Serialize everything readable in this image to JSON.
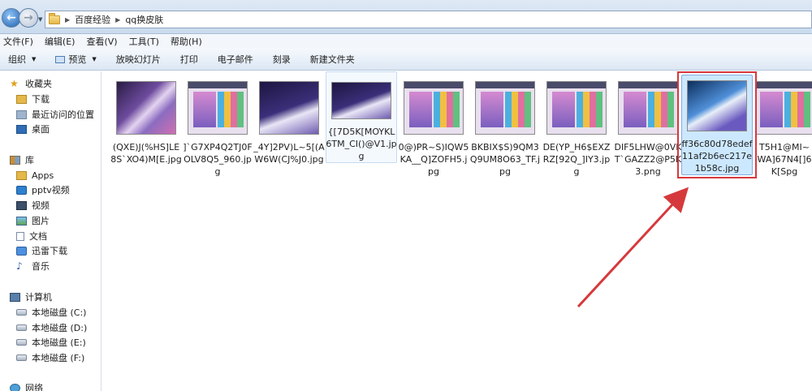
{
  "address": {
    "crumbs": [
      "百度经验",
      "qq换皮肤"
    ]
  },
  "menu": [
    "文件(F)",
    "编辑(E)",
    "查看(V)",
    "工具(T)",
    "帮助(H)"
  ],
  "commands": {
    "organize": "组织",
    "preview": "预览",
    "slideshow": "放映幻灯片",
    "print": "打印",
    "email": "电子邮件",
    "burn": "刻录",
    "new_folder": "新建文件夹"
  },
  "sidebar": {
    "favorites": "收藏夹",
    "downloads": "下载",
    "recent": "最近访问的位置",
    "desktop": "桌面",
    "libraries": "库",
    "apps": "Apps",
    "pptv": "pptv视频",
    "video": "视频",
    "pictures": "图片",
    "documents": "文档",
    "xunlei": "迅雷下载",
    "music": "音乐",
    "computer": "计算机",
    "disk_c": "本地磁盘 (C:)",
    "disk_d": "本地磁盘 (D:)",
    "disk_e": "本地磁盘 (E:)",
    "disk_f": "本地磁盘 (F:)",
    "network": "网络"
  },
  "files": [
    {
      "name": "(QXE)J(%HS]LE8S`XO4)M[E.jpg"
    },
    {
      "name": "]`G7XP4Q2TJ0FOLV8Q5_960.jpg"
    },
    {
      "name": "_4Y]2PV)L~5[(AW6W(CJ%J0.jpg"
    },
    {
      "name": "{[7D5K[MOYKL6TM_CI()@V1.jpg"
    },
    {
      "name": "0@)PR~S)IQW5KA__Q]ZOFH5.jpg"
    },
    {
      "name": "BKBIX$S)9QM3Q9UM8O63_TF.jpg"
    },
    {
      "name": "DE(YP_H6$EXZRZ[92Q_]IY3.jpg"
    },
    {
      "name": "DIF5LHW@0VKT`GAZZ2@P5K3.png"
    },
    {
      "name": "ff36c80d78edef11af2b6ec217e1b58c.jpg"
    },
    {
      "name": "T5H1@MI~WA]67N4[]6K[Spg"
    }
  ],
  "colors": {
    "highlight": "#d6393c",
    "selection": "#cce8ff"
  }
}
